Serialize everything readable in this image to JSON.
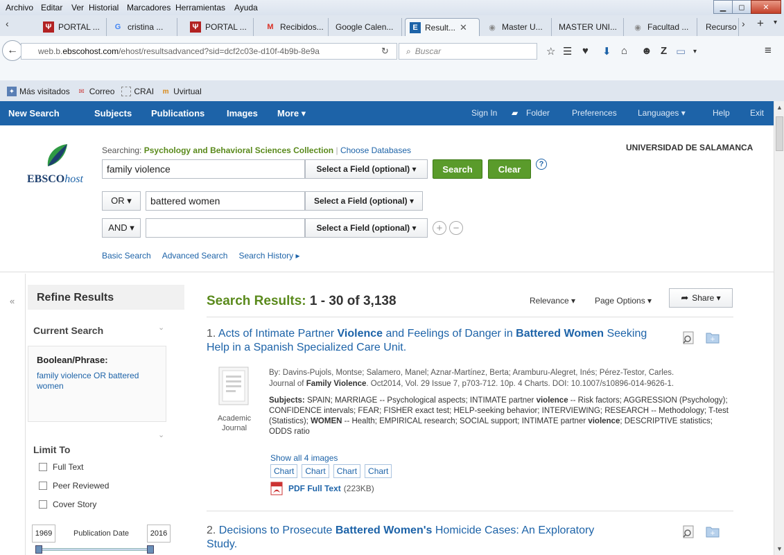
{
  "browser": {
    "menu": [
      "Archivo",
      "Editar",
      "Ver",
      "Historial",
      "Marcadores",
      "Herramientas",
      "Ayuda"
    ],
    "tabs": [
      {
        "label": "PORTAL ...",
        "icon": "Ψ"
      },
      {
        "label": "cristina ...",
        "icon": "G"
      },
      {
        "label": "PORTAL ...",
        "icon": "Ψ"
      },
      {
        "label": "Recibidos...",
        "icon": "M"
      },
      {
        "label": "Google Calen...",
        "icon": ""
      },
      {
        "label": "Result...",
        "icon": "E"
      },
      {
        "label": "Master U...",
        "icon": "◉"
      },
      {
        "label": "MASTER UNI...",
        "icon": ""
      },
      {
        "label": "Facultad ...",
        "icon": "◉"
      },
      {
        "label": "Recurso",
        "icon": ""
      }
    ],
    "url_prefix": "web.b.",
    "url_domain": "ebscohost.com",
    "url_path": "/ehost/resultsadvanced?sid=dcf2c03e-d10f-4b9b-8e9a",
    "search_placeholder": "Buscar",
    "bookmarks": [
      "Más visitados",
      "Correo",
      "CRAI",
      "Uvirtual"
    ]
  },
  "nav": {
    "left": [
      "New Search",
      "Subjects",
      "Publications",
      "Images",
      "More ▾"
    ],
    "right": [
      "Sign In",
      "Folder",
      "Preferences",
      "Languages ▾",
      "Help",
      "Exit"
    ]
  },
  "search": {
    "logo_text": "EBSCO",
    "logo_italic": "host",
    "searching_label": "Searching:",
    "database": "Psychology and Behavioral Sciences Collection",
    "choose_db": "Choose Databases",
    "institution": "UNIVERSIDAD DE SALAMANCA",
    "rows": [
      {
        "op": "",
        "term": "family violence",
        "field": "Select a Field (optional) ▾"
      },
      {
        "op": "OR ▾",
        "term": "battered women",
        "field": "Select a Field (optional) ▾"
      },
      {
        "op": "AND ▾",
        "term": "",
        "field": "Select a Field (optional) ▾"
      }
    ],
    "search_button": "Search",
    "clear_button": "Clear",
    "help": "?",
    "links": [
      "Basic Search",
      "Advanced Search",
      "Search History ▸"
    ]
  },
  "sidebar": {
    "collapse": "«",
    "title": "Refine Results",
    "current_search": "Current Search",
    "boolean_title": "Boolean/Phrase:",
    "boolean_value": "family violence OR battered women",
    "limit_to": "Limit To",
    "limits": [
      "Full Text",
      "Peer Reviewed",
      "Cover Story"
    ],
    "pub_from": "1969",
    "pub_label": "Publication Date",
    "pub_to": "2016"
  },
  "results": {
    "label": "Search Results:",
    "range": "1 - 30 of 3,138",
    "relevance": "Relevance ▾",
    "page_options": "Page Options ▾",
    "share": "Share ▾",
    "items": [
      {
        "num": "1.",
        "title_parts": [
          {
            "t": "Acts of Intimate Partner ",
            "b": false
          },
          {
            "t": "Violence",
            "b": true
          },
          {
            "t": " and Feelings of Danger in ",
            "b": false
          },
          {
            "t": "Battered Women",
            "b": true
          },
          {
            "t": " Seeking Help in a Spanish Specialized Care Unit.",
            "b": false
          }
        ],
        "authors": "By: Davins-Pujols, Montse; Salamero, Manel; Aznar-Martínez, Berta; Aramburu-Alegret, Inés; Pérez-Testor, Carles.",
        "journal_pre": "Journal of ",
        "journal_bold": "Family Violence",
        "journal_post": ". Oct2014, Vol. 29 Issue 7, p703-712. 10p. 4 Charts. DOI: 10.1007/s10896-014-9626-1.",
        "subjects_label": "Subjects:",
        "subjects_1": " SPAIN; MARRIAGE -- Psychological aspects; INTIMATE partner ",
        "subjects_b1": "violence",
        "subjects_2": " -- Risk factors; AGGRESSION (Psychology); CONFIDENCE intervals; FEAR; FISHER exact test; HELP-seeking behavior; INTERVIEWING; RESEARCH -- Methodology; T-test (Statistics); ",
        "subjects_b2": "WOMEN",
        "subjects_3": " -- Health; EMPIRICAL research; SOCIAL support; INTIMATE partner ",
        "subjects_b3": "violence",
        "subjects_4": "; DESCRIPTIVE statistics; ODDS ratio",
        "doc_type_1": "Academic",
        "doc_type_2": "Journal",
        "show_images": "Show all 4 images",
        "charts": [
          "Chart",
          "Chart",
          "Chart",
          "Chart"
        ],
        "pdf_label": "PDF Full Text",
        "pdf_size": "(223KB)"
      },
      {
        "num": "2.",
        "title_parts": [
          {
            "t": "Decisions to Prosecute ",
            "b": false
          },
          {
            "t": "Battered Women's",
            "b": true
          },
          {
            "t": " Homicide Cases: An Exploratory Study.",
            "b": false
          }
        ]
      }
    ]
  },
  "colors": {
    "nav_blue": "#1d63a8",
    "green": "#5a9b2b",
    "link": "#1d63a8"
  }
}
